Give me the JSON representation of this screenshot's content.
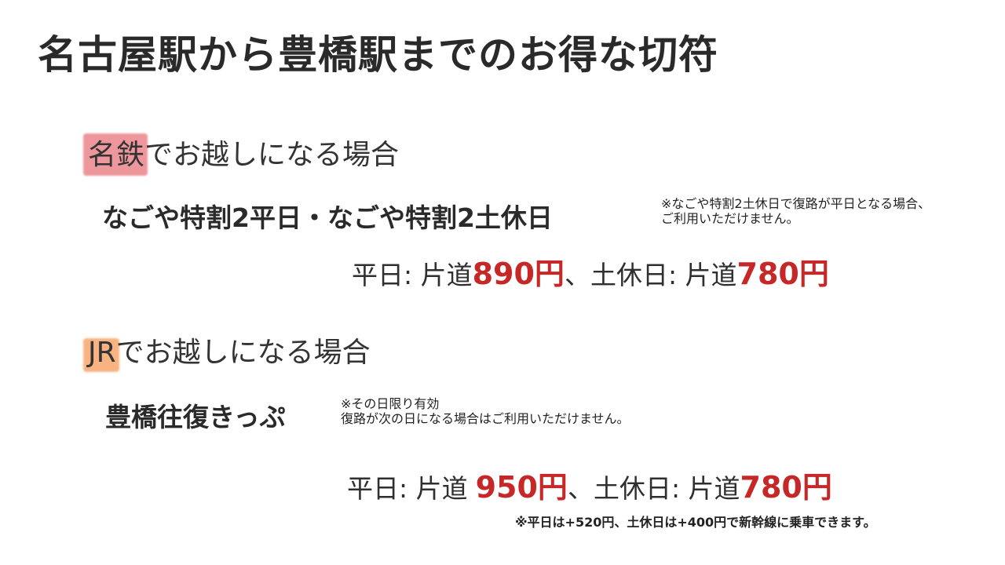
{
  "title": "名古屋駅から豊橋駅までのお得な切符",
  "colors": {
    "accent_red": "#c62828",
    "highlight_meitetsu": "#e8737a",
    "highlight_jr": "#f79a5a"
  },
  "meitetsu": {
    "company": "名鉄",
    "heading_rest": "でお越しになる場合",
    "ticket_name": "なごや特割2平日・なごや特割2土休日",
    "note_line1": "※なごや特割2土休日で復路が平日となる場合、",
    "note_line2": "ご利用いただけません。",
    "weekday_label": "平日: 片道",
    "weekday_price": "890円",
    "separator": "、",
    "holiday_label": "土休日: 片道",
    "holiday_price": "780円"
  },
  "jr": {
    "company": "JR",
    "heading_rest": "でお越しになる場合",
    "ticket_name": "豊橋往復きっぷ",
    "note_line1": "※その日限り有効",
    "note_line2": "復路が次の日になる場合はご利用いただけません。",
    "weekday_label": "平日: 片道",
    "weekday_price": "950円",
    "separator": "、",
    "holiday_label": "土休日: 片道",
    "holiday_price": "780円",
    "footnote": "※平日は+520円、土休日は+400円で新幹線に乗車できます。"
  }
}
